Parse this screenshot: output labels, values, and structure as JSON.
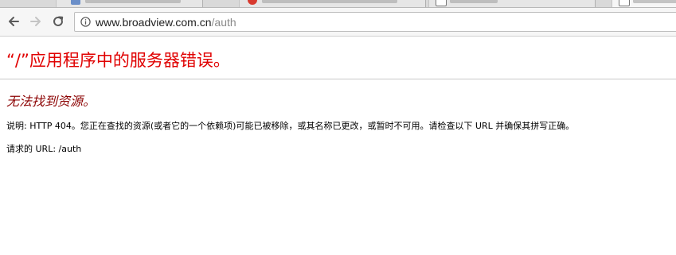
{
  "browser": {
    "url_host": "www.broadview.com.cn",
    "url_path": "/auth"
  },
  "page": {
    "title": "“/”应用程序中的服务器错误。",
    "subtitle": "无法找到资源。",
    "description_label": "说明:",
    "description_text": "HTTP 404。您正在查找的资源(或者它的一个依赖项)可能已被移除，或其名称已更改，或暂时不可用。请检查以下 URL 并确保其拼写正确。",
    "requested_url_label": "请求的 URL:",
    "requested_url_value": "/auth"
  },
  "colors": {
    "title": "#e00000",
    "subtitle": "#8b0000",
    "url_path": "#8a8a8a"
  },
  "icons": {
    "back": "arrow-left-icon",
    "forward": "arrow-right-icon",
    "reload": "reload-icon",
    "info": "info-icon"
  }
}
